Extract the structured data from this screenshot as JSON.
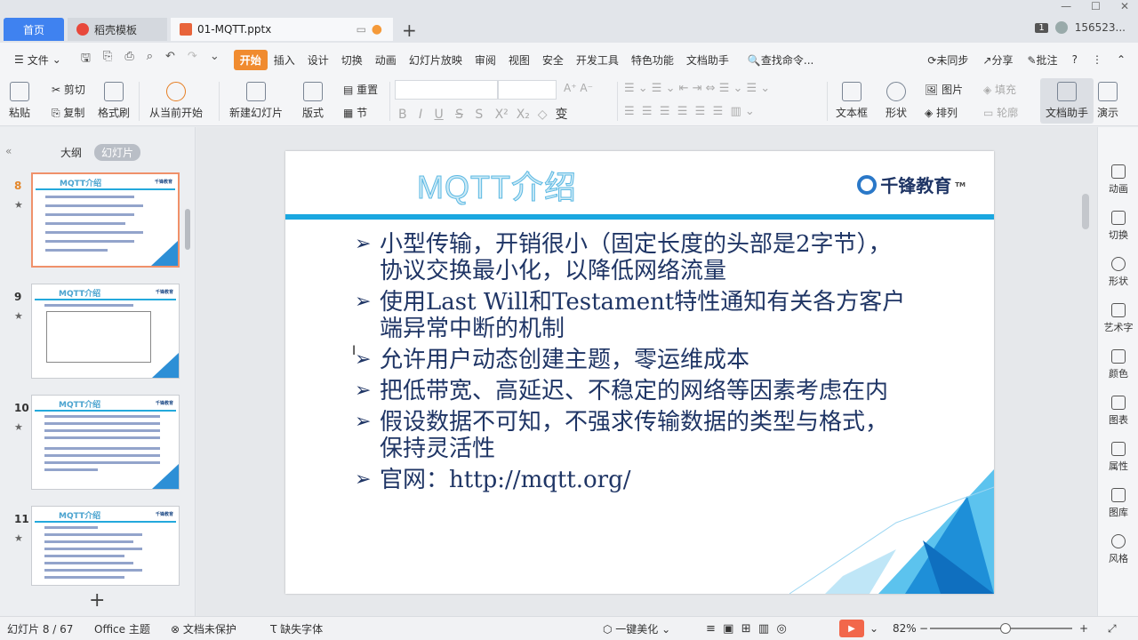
{
  "tabs": {
    "home": "首页",
    "template": "稻壳模板",
    "file": "01-MQTT.pptx"
  },
  "account": {
    "badge": "1",
    "user": "156523..."
  },
  "menu": {
    "file": "文件",
    "items": [
      "开始",
      "插入",
      "设计",
      "切换",
      "动画",
      "幻灯片放映",
      "审阅",
      "视图",
      "安全",
      "开发工具",
      "特色功能",
      "文档助手"
    ],
    "search": "查找命令...",
    "sync": "未同步",
    "share": "分享",
    "comment": "批注"
  },
  "ribbon": {
    "paste": "粘贴",
    "cut": "剪切",
    "copy": "复制",
    "format_painter": "格式刷",
    "from_current": "从当前开始",
    "new_slide": "新建幻灯片",
    "layout": "版式",
    "reset": "重置",
    "section": "节",
    "textbox": "文本框",
    "shape": "形状",
    "picture": "图片",
    "fill": "填充",
    "arrange": "排列",
    "outline": "轮廓",
    "doc_assistant": "文档助手",
    "presentation": "演示"
  },
  "left_panel": {
    "tab_outline": "大纲",
    "tab_slides": "幻灯片",
    "thumbs": [
      {
        "num": "8",
        "title": "MQTT介绍",
        "current": true
      },
      {
        "num": "9",
        "title": "MQTT介绍",
        "current": false
      },
      {
        "num": "10",
        "title": "MQTT介绍",
        "current": false
      },
      {
        "num": "11",
        "title": "MQTT介绍",
        "current": false
      }
    ]
  },
  "slide": {
    "title": "MQTT介绍",
    "logo": "千锋教育",
    "logo_tm": "TM",
    "bullets": [
      "小型传输，开销很小（固定长度的头部是2字节），协议交换最小化，以降低网络流量",
      "使用Last Will和Testament特性通知有关各方客户端异常中断的机制",
      "允许用户动态创建主题，零运维成本",
      "把低带宽、高延迟、不稳定的网络等因素考虑在内",
      "假设数据不可知，不强求传输数据的类型与格式，保持灵活性",
      "官网：http://mqtt.org/"
    ]
  },
  "right_tools": [
    "动画",
    "切换",
    "形状",
    "艺术字",
    "颜色",
    "图表",
    "属性",
    "图库",
    "风格"
  ],
  "status": {
    "slide_count": "幻灯片 8 / 67",
    "theme": "Office 主题",
    "protect": "文档未保护",
    "missing_font": "缺失字体",
    "beautify": "一键美化",
    "zoom": "82%",
    "zoom_fraction": 0.53
  }
}
